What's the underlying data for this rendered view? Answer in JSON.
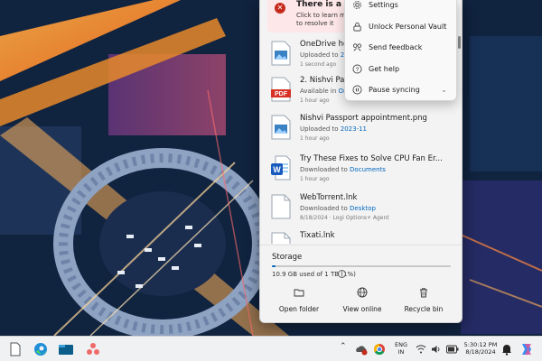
{
  "sync_banner": {
    "title": "There is a sync i",
    "line1": "Click to learn more",
    "line2": "to resolve it",
    "color": "#c42b1c"
  },
  "files": [
    {
      "name": "OneDrive ho",
      "status": "Uploaded to",
      "link": "202",
      "time": "1 second ago",
      "icon": "image-file-icon"
    },
    {
      "name": "2. Nishvi Pass",
      "status": "Available in",
      "link": "Or",
      "time": "1 hour ago",
      "icon": "pdf-file-icon"
    },
    {
      "name": "Nishvi Passport appointment.png",
      "status": "Uploaded to",
      "link": "2023-11",
      "time": "1 hour ago",
      "icon": "image-file-icon"
    },
    {
      "name": "Try These Fixes to Solve CPU Fan Er...",
      "status": "Downloaded to",
      "link": "Documents",
      "time": "1 hour ago",
      "icon": "word-file-icon"
    },
    {
      "name": "WebTorrent.lnk",
      "status": "Downloaded to",
      "link": "Desktop",
      "time": "8/18/2024 · Logi Options+ Agent",
      "icon": "shortcut-file-icon"
    },
    {
      "name": "Tixati.lnk",
      "status": "",
      "link": "",
      "time": "",
      "icon": "shortcut-file-icon"
    }
  ],
  "pdf_label": "PDF",
  "storage": {
    "label": "Storage",
    "used_text": "10.9 GB used of 1 TB (1%)",
    "used_percent": 1,
    "accent": "#0067c0"
  },
  "actions": [
    {
      "label": "Open folder",
      "icon": "folder-icon"
    },
    {
      "label": "View online",
      "icon": "globe-icon"
    },
    {
      "label": "Recycle bin",
      "icon": "trash-icon"
    }
  ],
  "menu": [
    {
      "label": "Settings",
      "icon": "gear-icon"
    },
    {
      "label": "Unlock Personal Vault",
      "icon": "lock-icon"
    },
    {
      "label": "Send feedback",
      "icon": "feedback-icon"
    },
    {
      "label": "Get help",
      "icon": "help-icon"
    },
    {
      "label": "Pause syncing",
      "icon": "pause-icon"
    }
  ],
  "taskbar": {
    "lang_top": "ENG",
    "lang_bottom": "IN",
    "time": "5:30:12 PM",
    "date": "8/18/2024"
  }
}
